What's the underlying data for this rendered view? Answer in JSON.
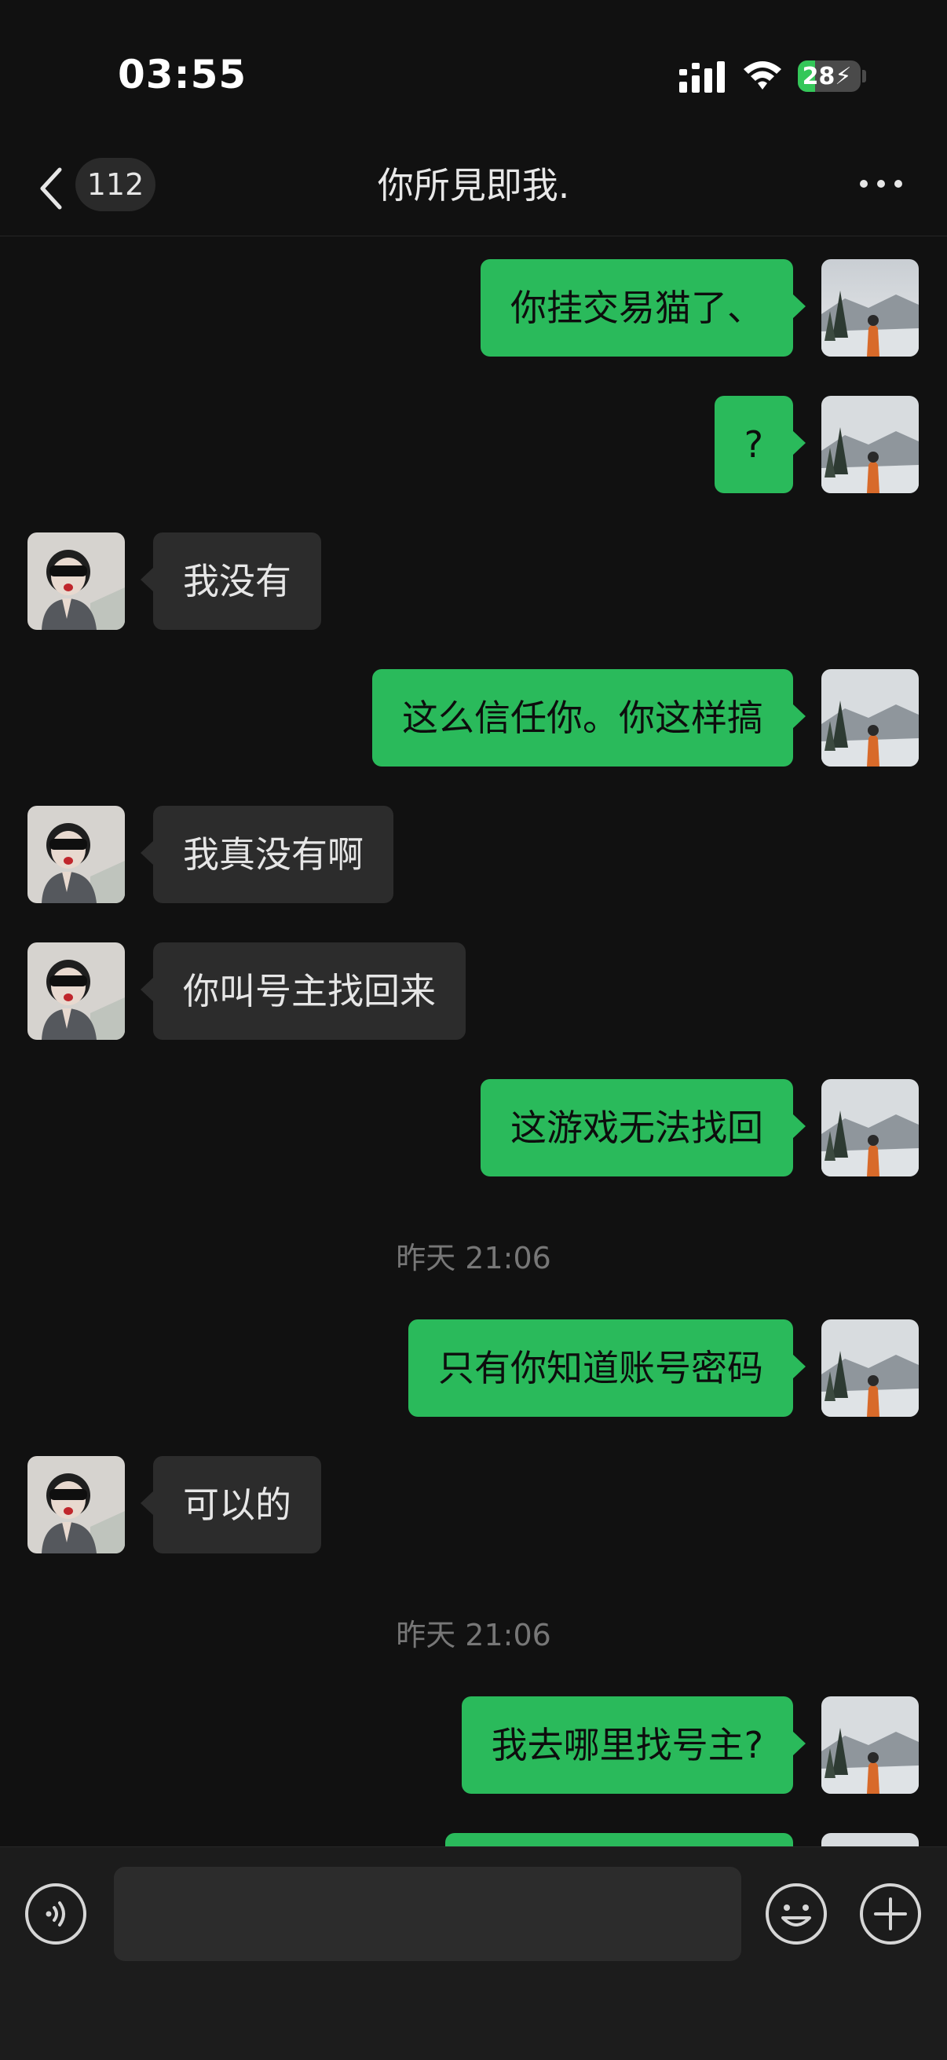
{
  "status_bar": {
    "time": "03:55",
    "battery": "28",
    "battery_level": 0.28
  },
  "header": {
    "unread_count": "112",
    "title": "你所見即我."
  },
  "messages": [
    {
      "side": "out",
      "text": "你挂交易猫了、"
    },
    {
      "side": "out",
      "text": "?"
    },
    {
      "side": "in",
      "text": "我没有"
    },
    {
      "side": "out",
      "text": "这么信任你。你这样搞"
    },
    {
      "side": "in",
      "text": "我真没有啊"
    },
    {
      "side": "in",
      "text": "你叫号主找回来"
    },
    {
      "side": "out",
      "text": "这游戏无法找回"
    },
    {
      "timestamp": "昨天 21:06"
    },
    {
      "side": "out",
      "text": "只有你知道账号密码"
    },
    {
      "side": "in",
      "text": "可以的"
    },
    {
      "timestamp": "昨天 21:06"
    },
    {
      "side": "out",
      "text": "我去哪里找号主?"
    },
    {
      "side": "out",
      "text": ""
    }
  ],
  "input_bar": {
    "placeholder": ""
  },
  "icons": {
    "back": "chevron-left-icon",
    "more": "more-dots-icon",
    "voice": "voice-icon",
    "emoji": "emoji-icon",
    "plus": "plus-icon"
  },
  "colors": {
    "background": "#111111",
    "outgoing_bubble": "#2aba5b",
    "incoming_bubble": "#2c2c2c",
    "input_bar": "#1c1c1c"
  }
}
